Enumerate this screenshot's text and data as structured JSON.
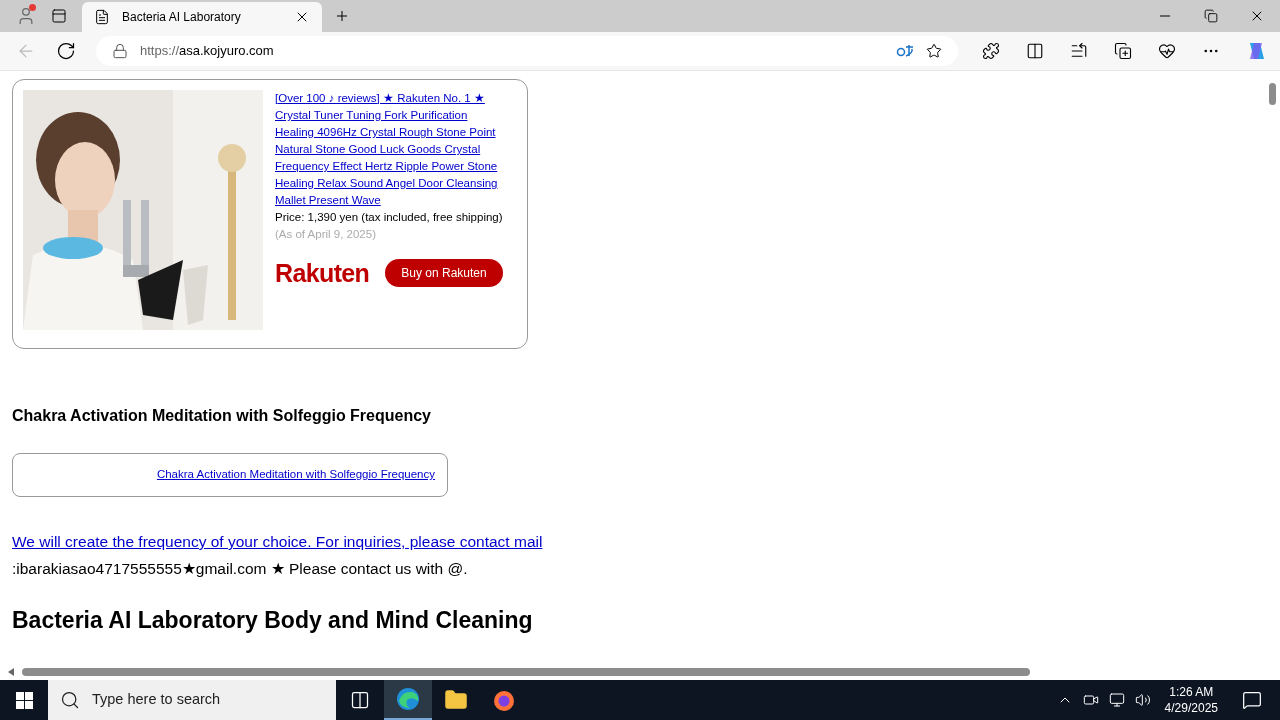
{
  "browser": {
    "tabs": [
      {
        "title": "Bacteria AI Laboratory",
        "selected": true
      }
    ],
    "address": {
      "scheme": "https://",
      "host": "asa.kojyuro.com"
    }
  },
  "ad": {
    "kind": "picture",
    "title": "[Over 100 ♪ reviews] ★ Rakuten No. 1 ★ Crystal Tuner Tuning Fork Purification Healing 4096Hz Crystal Rough Stone Point Natural Stone Good Luck Goods Crystal Frequency Effect Hertz Ripple Power Stone Healing Relax Sound Angel Door Cleansing Mallet Present Wave",
    "price": "Price: 1,390 yen (tax included, free shipping)",
    "as_of": "(As of April 9, 2025)",
    "logo": "Rakuten",
    "button": "Buy on Rakuten"
  },
  "section_heading": "Chakra Activation Meditation with Solfeggio Frequency",
  "link_card": {
    "link": "Chakra Activation Meditation with Solfeggio Frequency"
  },
  "contact": {
    "link": "We will create the frequency of your choice. For inquiries, please contact mail",
    "text": ":ibarakiasao4717555555★gmail.com ★ Please contact us with @."
  },
  "page_heading": "Bacteria AI Laboratory Body and Mind Cleaning",
  "taskbar": {
    "search_placeholder": "Type here to search",
    "time": "1:26 AM",
    "date": "4/29/2025"
  }
}
